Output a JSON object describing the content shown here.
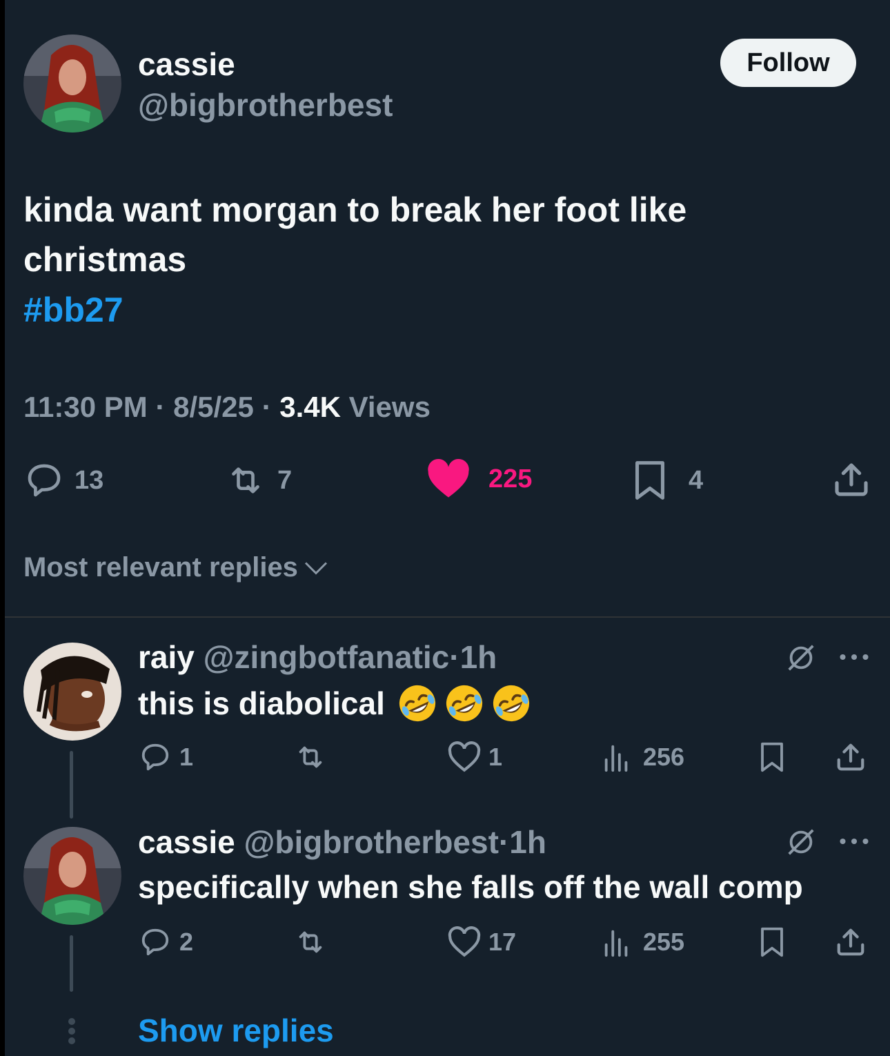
{
  "tweet": {
    "author_name": "cassie",
    "author_handle": "@bigbrotherbest",
    "follow_label": "Follow",
    "text_line1": "kinda want morgan to break her foot like",
    "text_line2": "christmas",
    "hashtag": "#bb27",
    "time": "11:30 PM",
    "date": "8/5/25",
    "views_count": "3.4K",
    "views_label": "Views",
    "dot": "·",
    "replies": "13",
    "retweets": "7",
    "likes": "225",
    "bookmarks": "4",
    "like_color": "#f91880",
    "accent_color": "#1d9bf0"
  },
  "sort": {
    "label": "Most relevant replies"
  },
  "replies": [
    {
      "name": "raiy",
      "handle": "@zingbotfanatic",
      "time": "1h",
      "text": "this is diabolical",
      "emoji_count": 3,
      "replies": "1",
      "retweets": "",
      "likes": "1",
      "views": "256"
    },
    {
      "name": "cassie",
      "handle": "@bigbrotherbest",
      "time": "1h",
      "text": "specifically when she falls off the wall comp",
      "replies": "2",
      "retweets": "",
      "likes": "17",
      "views": "255"
    }
  ],
  "show_replies_label": "Show replies",
  "icons": [
    "reply-icon",
    "retweet-icon",
    "heart-icon",
    "bookmark-icon",
    "share-icon",
    "grok-icon",
    "more-icon",
    "views-icon",
    "chevron-down-icon",
    "rofl-emoji"
  ]
}
